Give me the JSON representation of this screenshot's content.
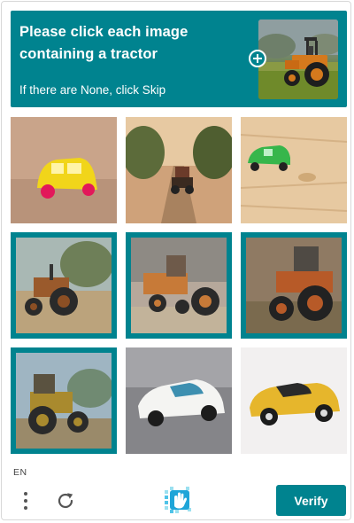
{
  "header": {
    "prompt_line1": "Please click each image",
    "prompt_line2": "containing a tractor",
    "hint": "If there are None, click Skip",
    "example_icon": "plus-icon"
  },
  "colors": {
    "accent": "#00838f",
    "text_on_accent": "#ffffff"
  },
  "grid": {
    "tiles": [
      {
        "content": "yellow toy car",
        "selected": false
      },
      {
        "content": "tractor on road",
        "selected": false
      },
      {
        "content": "green toy car",
        "selected": false
      },
      {
        "content": "tractor",
        "selected": true
      },
      {
        "content": "tractor",
        "selected": true
      },
      {
        "content": "tractor",
        "selected": true
      },
      {
        "content": "tractor",
        "selected": true
      },
      {
        "content": "white toy car",
        "selected": false
      },
      {
        "content": "yellow toy car",
        "selected": false
      }
    ]
  },
  "footer": {
    "language": "EN",
    "menu_icon": "more-vertical-icon",
    "refresh_icon": "refresh-icon",
    "logo_icon": "hand-logo-icon",
    "verify_label": "Verify"
  }
}
